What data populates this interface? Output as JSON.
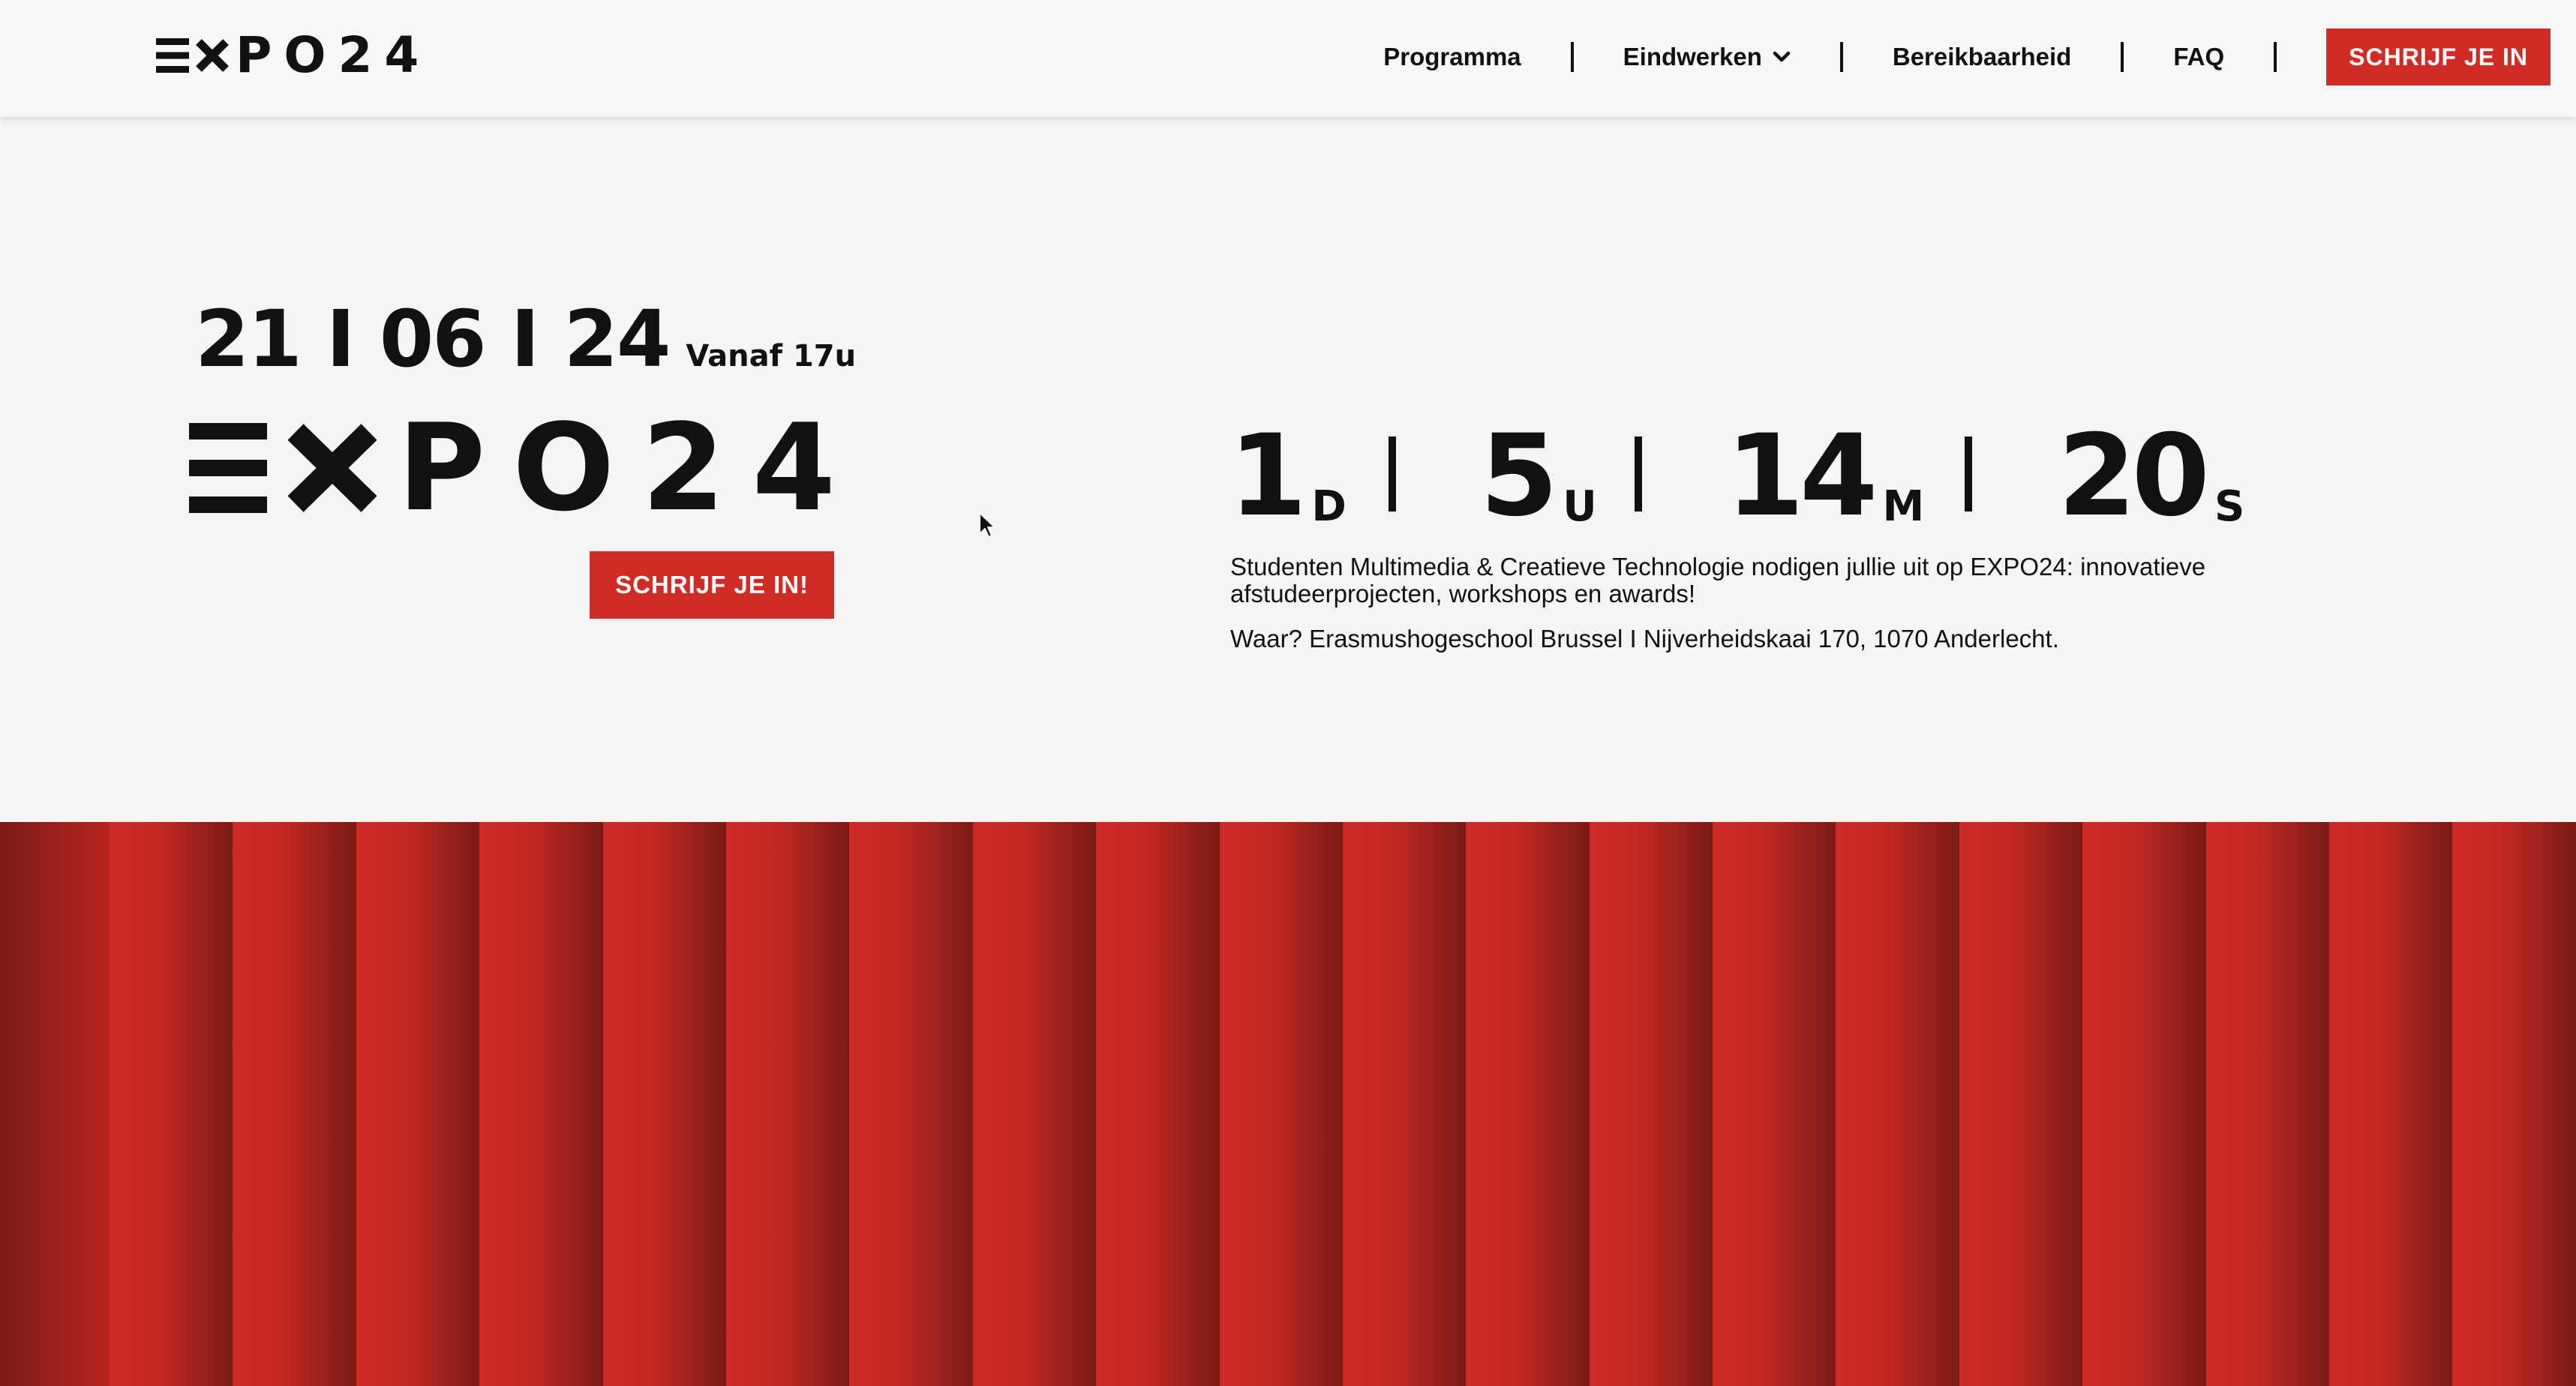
{
  "header": {
    "logo_text": "EXPO24",
    "nav": [
      {
        "label": "Programma"
      },
      {
        "label": "Eindwerken"
      },
      {
        "label": "Bereikbaarheid"
      },
      {
        "label": "FAQ"
      }
    ],
    "cta": "SCHRIJF JE IN"
  },
  "hero": {
    "date": "21 I 06 I 24",
    "time": "Vanaf 17u",
    "logo_text": "EXPO24",
    "cta": "SCHRIJF JE IN!"
  },
  "countdown": {
    "days": "1",
    "days_unit": "D",
    "hours": "5",
    "hours_unit": "U",
    "minutes": "14",
    "minutes_unit": "M",
    "seconds": "20",
    "seconds_unit": "S"
  },
  "info": {
    "description": "Studenten Multimedia & Creatieve Technologie nodigen jullie uit op EXPO24: innovatieve afstudeerprojecten, workshops en awards!",
    "address": "Waar? Erasmushogeschool Brussel I Nijverheidskaai 170, 1070 Anderlecht."
  },
  "colors": {
    "accent": "#d22a25",
    "text": "#111111",
    "background": "#f5f5f5",
    "curtain_light": "#cf2a26",
    "curtain_dark": "#7a1b16"
  }
}
